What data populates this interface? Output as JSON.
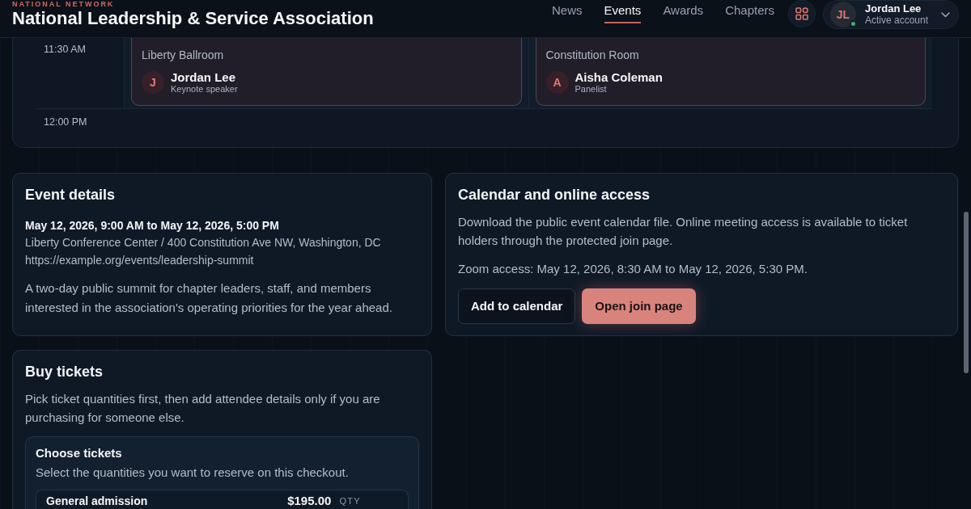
{
  "header": {
    "eyebrow": "NATIONAL NETWORK",
    "title": "National Leadership & Service Association"
  },
  "nav": [
    {
      "label": "News",
      "selected": false
    },
    {
      "label": "Events",
      "selected": true
    },
    {
      "label": "Awards",
      "selected": false
    },
    {
      "label": "Chapters",
      "selected": false
    }
  ],
  "account": {
    "initials": "JL",
    "name": "Jordan Lee",
    "status": "Active account",
    "online": true
  },
  "schedule": {
    "rows": [
      {
        "time": "11:30 AM",
        "sessions": [
          {
            "location": "Liberty Ballroom",
            "speaker": {
              "initial": "J",
              "name": "Jordan Lee",
              "role": "Keynote speaker"
            }
          },
          {
            "location": "Constitution Room",
            "speaker": {
              "initial": "A",
              "name": "Aisha Coleman",
              "role": "Panelist"
            }
          }
        ]
      },
      {
        "time": "12:00 PM"
      }
    ]
  },
  "event_details": {
    "title": "Event details",
    "datetime": "May 12, 2026, 9:00 AM to May 12, 2026, 5:00 PM",
    "address": "Liberty Conference Center / 400 Constitution Ave NW, Washington, DC",
    "url": "https://example.org/events/leadership-summit",
    "description": "A two-day public summit for chapter leaders, staff, and members interested in the association's operating priorities for the year ahead."
  },
  "calendar_access": {
    "title": "Calendar and online access",
    "description": "Download the public event calendar file. Online meeting access is available to ticket holders through the protected join page.",
    "zoom_access": "Zoom access: May 12, 2026, 8:30 AM to May 12, 2026, 5:30 PM.",
    "buttons": [
      {
        "label": "Add to calendar",
        "kind": "secondary"
      },
      {
        "label": "Open join page",
        "kind": "primary"
      }
    ]
  },
  "buy_tickets": {
    "title": "Buy tickets",
    "description": "Pick ticket quantities first, then add attendee details only if you are purchasing for someone else.",
    "choose_tickets": {
      "title": "Choose tickets",
      "description": "Select the quantities you want to reserve on this checkout.",
      "tickets": [
        {
          "name": "General admission",
          "price": "$195.00",
          "qty_label": "QTY"
        }
      ]
    }
  }
}
